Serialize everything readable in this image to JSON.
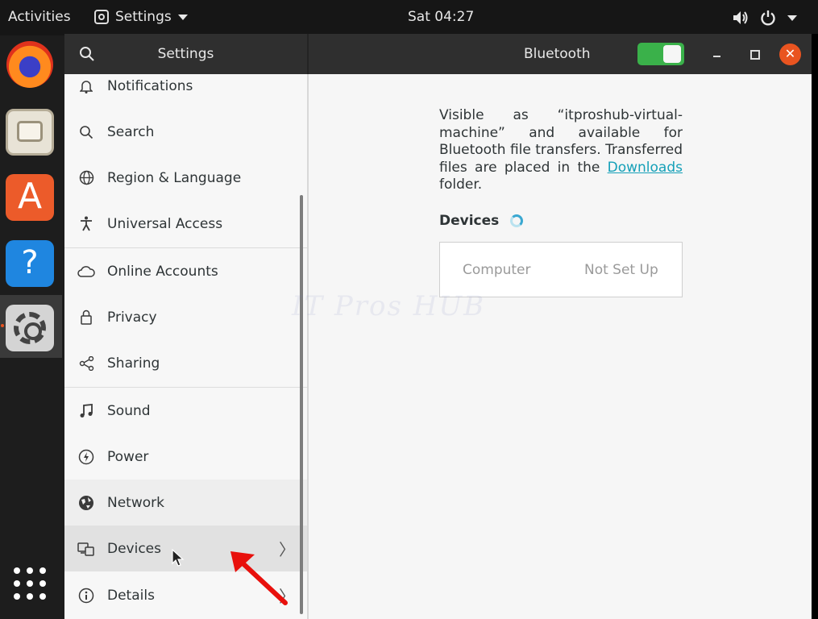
{
  "topbar": {
    "activities": "Activities",
    "app_name": "Settings",
    "clock": "Sat 04:27"
  },
  "dock": {
    "apps": [
      "firefox-icon",
      "files-icon",
      "software-icon",
      "help-icon",
      "settings-icon",
      "show-apps-icon"
    ],
    "running_indicator_color": "#e95420"
  },
  "window": {
    "sidebar_title": "Settings",
    "panel_title": "Bluetooth",
    "bluetooth_enabled": true,
    "close_button_color": "#e95420"
  },
  "sidebar": {
    "items": [
      {
        "label": "Notifications",
        "icon": "bell-icon"
      },
      {
        "label": "Search",
        "icon": "search-icon"
      },
      {
        "label": "Region & Language",
        "icon": "globe-icon"
      },
      {
        "label": "Universal Access",
        "icon": "accessibility-icon"
      },
      {
        "label": "Online Accounts",
        "icon": "cloud-icon"
      },
      {
        "label": "Privacy",
        "icon": "lock-icon"
      },
      {
        "label": "Sharing",
        "icon": "share-icon"
      },
      {
        "label": "Sound",
        "icon": "music-note-icon"
      },
      {
        "label": "Power",
        "icon": "power-icon"
      },
      {
        "label": "Network",
        "icon": "network-icon"
      },
      {
        "label": "Devices",
        "icon": "devices-icon",
        "selected": true
      },
      {
        "label": "Details",
        "icon": "info-icon"
      }
    ]
  },
  "content": {
    "visible_prefix": "Visible as “itproshub-virtual-machine” and available for Bluetooth file transfers. Transferred files are placed in the",
    "downloads_link": "Downloads",
    "folder_suffix": "folder.",
    "devices_heading": "Devices",
    "devices": [
      {
        "name": "Computer",
        "status": "Not Set Up"
      }
    ],
    "watermark": "IT Pros HUB",
    "link_color": "#15a0b8",
    "toggle_color": "#3ab14a"
  }
}
